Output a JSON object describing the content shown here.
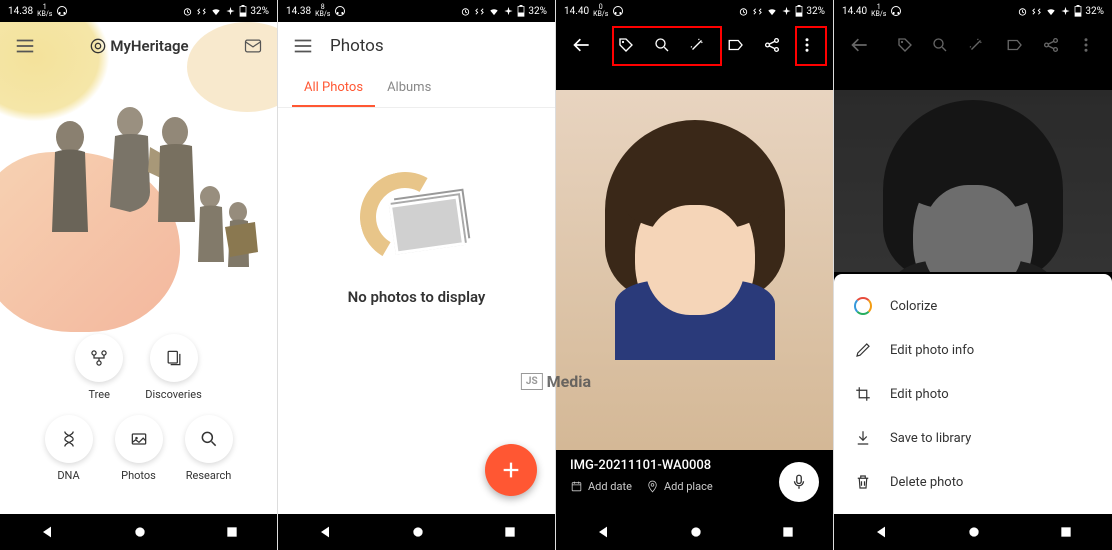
{
  "status": {
    "time1": "14.38",
    "time2": "14.38",
    "time3": "14.40",
    "time4": "14.40",
    "net1": "1",
    "net2": "8",
    "net3": "0",
    "net4": "1",
    "net_unit": "KB/s",
    "battery": "32%"
  },
  "screen1": {
    "app_name": "MyHeritage",
    "nav": {
      "tree": "Tree",
      "discoveries": "Discoveries",
      "dna": "DNA",
      "photos": "Photos",
      "research": "Research"
    }
  },
  "screen2": {
    "title": "Photos",
    "tabs": {
      "all": "All Photos",
      "albums": "Albums"
    },
    "empty": "No photos to display"
  },
  "screen3": {
    "filename": "IMG-20211101-WA0008",
    "add_date": "Add date",
    "add_place": "Add place"
  },
  "screen4": {
    "menu": {
      "colorize": "Colorize",
      "edit_info": "Edit photo info",
      "edit_photo": "Edit photo",
      "save": "Save to library",
      "delete": "Delete photo"
    }
  },
  "watermark": {
    "box": "JS",
    "text": "Media"
  }
}
